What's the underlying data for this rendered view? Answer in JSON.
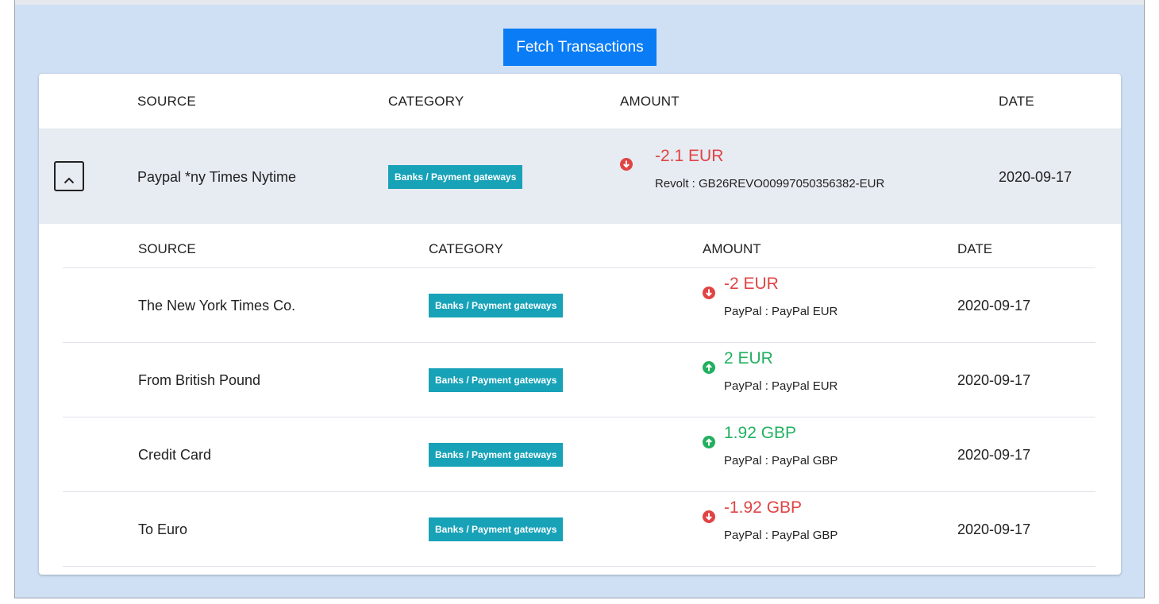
{
  "toolbar": {
    "fetch_label": "Fetch Transactions"
  },
  "table": {
    "headers": {
      "source": "SOURCE",
      "category": "CATEGORY",
      "amount": "AMOUNT",
      "date": "DATE"
    },
    "main_row": {
      "source": "Paypal *ny Times Nytime",
      "category": "Banks / Payment gateways",
      "amount": "-2.1 EUR",
      "direction": "down",
      "account": "Revolt : GB26REVO00997050356382-EUR",
      "date": "2020-09-17",
      "expanded": true,
      "toggle_icon": "chevron-up-icon"
    },
    "sub_headers": {
      "source": "SOURCE",
      "category": "CATEGORY",
      "amount": "AMOUNT",
      "date": "DATE"
    },
    "sub_rows": [
      {
        "source": "The New York Times Co.",
        "category": "Banks / Payment gateways",
        "amount": "-2 EUR",
        "direction": "down",
        "account": "PayPal : PayPal EUR",
        "date": "2020-09-17"
      },
      {
        "source": "From British Pound",
        "category": "Banks / Payment gateways",
        "amount": "2 EUR",
        "direction": "up",
        "account": "PayPal : PayPal EUR",
        "date": "2020-09-17"
      },
      {
        "source": "Credit Card",
        "category": "Banks / Payment gateways",
        "amount": "1.92 GBP",
        "direction": "up",
        "account": "PayPal : PayPal GBP",
        "date": "2020-09-17"
      },
      {
        "source": "To Euro",
        "category": "Banks / Payment gateways",
        "amount": "-1.92 GBP",
        "direction": "down",
        "account": "PayPal : PayPal GBP",
        "date": "2020-09-17"
      }
    ]
  },
  "colors": {
    "page_background": "#cfe0f5",
    "button": "#0a7cf5",
    "badge": "#17a2b8",
    "negative": "#e04444",
    "positive": "#22b060",
    "expanded_row": "#e7ebf2"
  }
}
